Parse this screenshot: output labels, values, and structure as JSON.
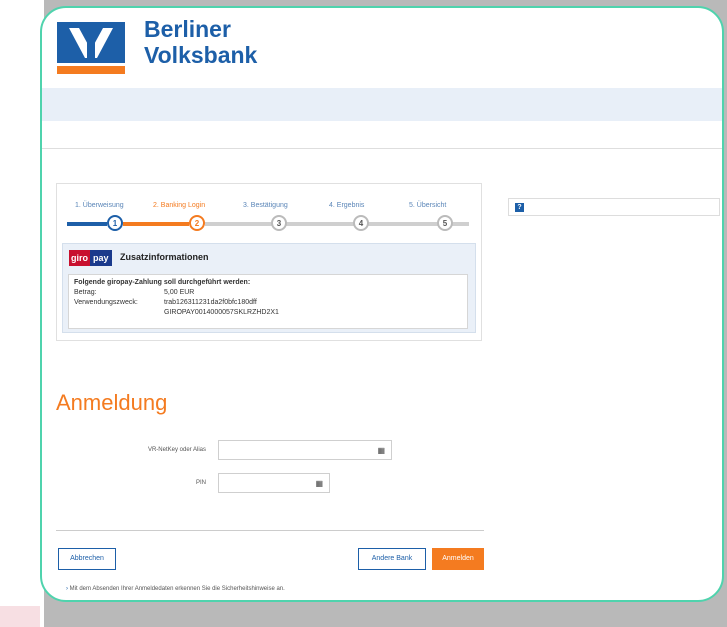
{
  "brand": {
    "line1": "Berliner",
    "line2": "Volksbank"
  },
  "colors": {
    "accent": "#f47b20",
    "brand_blue": "#1d5fa8",
    "frame": "#4fd3ad",
    "giro_red": "#c8102e",
    "giro_blue": "#1b3a8c"
  },
  "steps": [
    {
      "label": "1. Überweisung",
      "num": "1",
      "state": "done"
    },
    {
      "label": "2. Banking Login",
      "num": "2",
      "state": "active"
    },
    {
      "label": "3. Bestätigung",
      "num": "3",
      "state": "pending"
    },
    {
      "label": "4. Ergebnis",
      "num": "4",
      "state": "pending"
    },
    {
      "label": "5. Übersicht",
      "num": "5",
      "state": "pending"
    }
  ],
  "giropay": {
    "logo_part1": "giro",
    "logo_part2": "pay",
    "title": "Zusatzinformationen",
    "intro": "Folgende giropay-Zahlung soll durchgeführt werden:",
    "amount_label": "Betrag:",
    "amount_value": "5,00 EUR",
    "purpose_label": "Verwendungszweck:",
    "purpose_line1": "trab126311231da2f0bfc180dff",
    "purpose_line2": "GIROPAY0014000057SKLRZHD2X1"
  },
  "help_icon": "?",
  "login": {
    "heading": "Anmeldung",
    "user_label": "VR-NetKey oder Alias",
    "user_value": "",
    "pin_label": "PIN",
    "pin_value": "",
    "keyboard_icon": "keyboard-icon"
  },
  "buttons": {
    "cancel": "Abbrechen",
    "other_bank": "Andere Bank",
    "login": "Anmelden"
  },
  "security_note": "Mit dem Absenden Ihrer Anmeldedaten erkennen Sie die Sicherheitshinweise an."
}
